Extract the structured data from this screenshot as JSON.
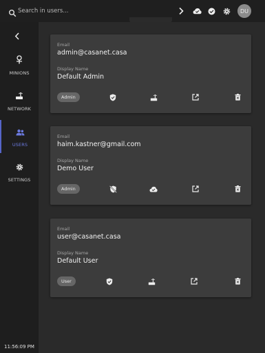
{
  "search": {
    "placeholder": "Search in users..."
  },
  "header": {
    "avatar_initials": "DU"
  },
  "sidebar": {
    "items": [
      {
        "label": "MINIONS",
        "icon": "minion-icon"
      },
      {
        "label": "NETWORK",
        "icon": "router-icon"
      },
      {
        "label": "USERS",
        "icon": "users-icon",
        "active": true
      },
      {
        "label": "SETTINGS",
        "icon": "gear-icon"
      }
    ],
    "clock": "11:56:09 PM"
  },
  "labels": {
    "email": "Email",
    "display_name": "Display Name"
  },
  "users": [
    {
      "email": "admin@casanet.casa",
      "display_name": "Default Admin",
      "role": "Admin",
      "auth_icon": "shield-check-icon",
      "forward_icon": "router-icon"
    },
    {
      "email": "haim.kastner@gmail.com",
      "display_name": "Demo User",
      "role": "Admin",
      "auth_icon": "shield-off-icon",
      "forward_icon": "cloud-check-icon"
    },
    {
      "email": "user@casanet.casa",
      "display_name": "Default User",
      "role": "User",
      "auth_icon": "shield-check-icon",
      "forward_icon": "router-icon"
    }
  ],
  "colors": {
    "accent": "#5665c8",
    "card": "#3c3c3c",
    "background": "#2a2a2a",
    "sidebar": "#1e1e1e"
  }
}
